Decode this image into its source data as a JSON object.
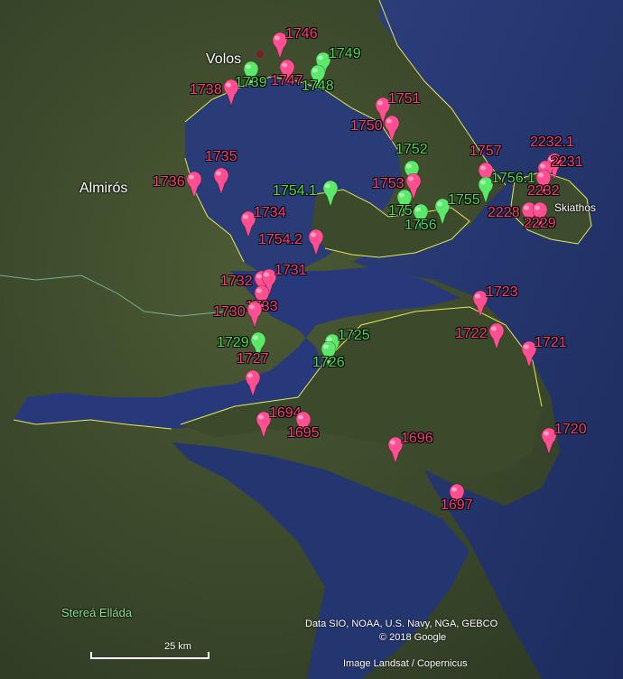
{
  "places": [
    {
      "id": "volos",
      "text": "Volos"
    },
    {
      "id": "almiros",
      "text": "Almirós"
    },
    {
      "id": "skiathos",
      "text": "Skiathos"
    },
    {
      "id": "sterea",
      "text": "Stereá Elláda"
    }
  ],
  "attribution": {
    "data": "Data SIO, NOAA, U.S. Navy, NGA, GEBCO",
    "copyright": "© 2018 Google",
    "image": "Image Landsat / Copernicus"
  },
  "scale": {
    "label": "25 km"
  },
  "colors": {
    "pink_marker": "#ff4f93",
    "green_marker": "#5ce86a",
    "pink_label": "#ff3d7a",
    "green_label": "#4be04b",
    "sea": "#25366e",
    "land": "#3b4a2c",
    "coastline": "#e8e85a"
  },
  "markers": [
    {
      "id": "m1746",
      "label": "1746",
      "color": "pink",
      "label_side": "right"
    },
    {
      "id": "m1747",
      "label": "1747",
      "color": "pink",
      "label_side": "below"
    },
    {
      "id": "m1749",
      "label": "1749",
      "color": "green",
      "label_side": "right"
    },
    {
      "id": "m1748",
      "label": "1748",
      "color": "green",
      "label_side": "below"
    },
    {
      "id": "m1739",
      "label": "1739",
      "color": "green",
      "label_side": "below"
    },
    {
      "id": "m1738",
      "label": "1738",
      "color": "pink",
      "label_side": "left"
    },
    {
      "id": "m1751",
      "label": "1751",
      "color": "pink",
      "label_side": "right"
    },
    {
      "id": "m1750",
      "label": "1750",
      "color": "pink",
      "label_side": "left"
    },
    {
      "id": "m1752",
      "label": "1752",
      "color": "green",
      "label_side": "above"
    },
    {
      "id": "m1757",
      "label": "1757",
      "color": "pink",
      "label_side": "above"
    },
    {
      "id": "m1756.1",
      "label": "1756.1",
      "color": "green",
      "label_side": "right"
    },
    {
      "id": "m1753",
      "label": "1753",
      "color": "pink",
      "label_side": "left"
    },
    {
      "id": "m1754",
      "label": "1754",
      "color": "green",
      "label_side": "below"
    },
    {
      "id": "m1755",
      "label": "1755",
      "color": "green",
      "label_side": "right"
    },
    {
      "id": "m1756",
      "label": "1756",
      "color": "green",
      "label_side": "below"
    },
    {
      "id": "m1754.1",
      "label": "1754.1",
      "color": "green",
      "label_side": "left"
    },
    {
      "id": "m1754.2",
      "label": "1754.2",
      "color": "pink",
      "label_side": "left"
    },
    {
      "id": "m1736",
      "label": "1736",
      "color": "pink",
      "label_side": "left"
    },
    {
      "id": "m1735",
      "label": "1735",
      "color": "pink",
      "label_side": "above"
    },
    {
      "id": "m1734",
      "label": "1734",
      "color": "pink",
      "label_side": "right"
    },
    {
      "id": "m1732",
      "label": "1732",
      "color": "pink",
      "label_side": "left"
    },
    {
      "id": "m1731",
      "label": "1731",
      "color": "pink",
      "label_side": "right"
    },
    {
      "id": "m1733",
      "label": "1733",
      "color": "pink",
      "label_side": "below"
    },
    {
      "id": "m1730",
      "label": "1730",
      "color": "pink",
      "label_side": "left"
    },
    {
      "id": "m1729",
      "label": "1729",
      "color": "green",
      "label_side": "left"
    },
    {
      "id": "m1725",
      "label": "1725",
      "color": "green",
      "label_side": "right"
    },
    {
      "id": "m1726",
      "label": "1726",
      "color": "green",
      "label_side": "below"
    },
    {
      "id": "m1727",
      "label": "1727",
      "color": "pink",
      "label_side": "above"
    },
    {
      "id": "m1694",
      "label": "1694",
      "color": "pink",
      "label_side": "right"
    },
    {
      "id": "m1695",
      "label": "1695",
      "color": "pink",
      "label_side": "below"
    },
    {
      "id": "m1696",
      "label": "1696",
      "color": "pink",
      "label_side": "right"
    },
    {
      "id": "m1697",
      "label": "1697",
      "color": "pink",
      "label_side": "below"
    },
    {
      "id": "m1723",
      "label": "1723",
      "color": "pink",
      "label_side": "right"
    },
    {
      "id": "m1722",
      "label": "1722",
      "color": "pink",
      "label_side": "left"
    },
    {
      "id": "m1721",
      "label": "1721",
      "color": "pink",
      "label_side": "right"
    },
    {
      "id": "m1720",
      "label": "1720",
      "color": "pink",
      "label_side": "right"
    },
    {
      "id": "m2232.1",
      "label": "2232.1",
      "color": "pink",
      "label_side": "above"
    },
    {
      "id": "m2231",
      "label": "2231",
      "color": "pink",
      "label_side": "right"
    },
    {
      "id": "m2232",
      "label": "2232",
      "color": "pink",
      "label_side": "below"
    },
    {
      "id": "m2228",
      "label": "2228",
      "color": "pink",
      "label_side": "left"
    },
    {
      "id": "m2229",
      "label": "2229",
      "color": "pink",
      "label_side": "below"
    }
  ]
}
